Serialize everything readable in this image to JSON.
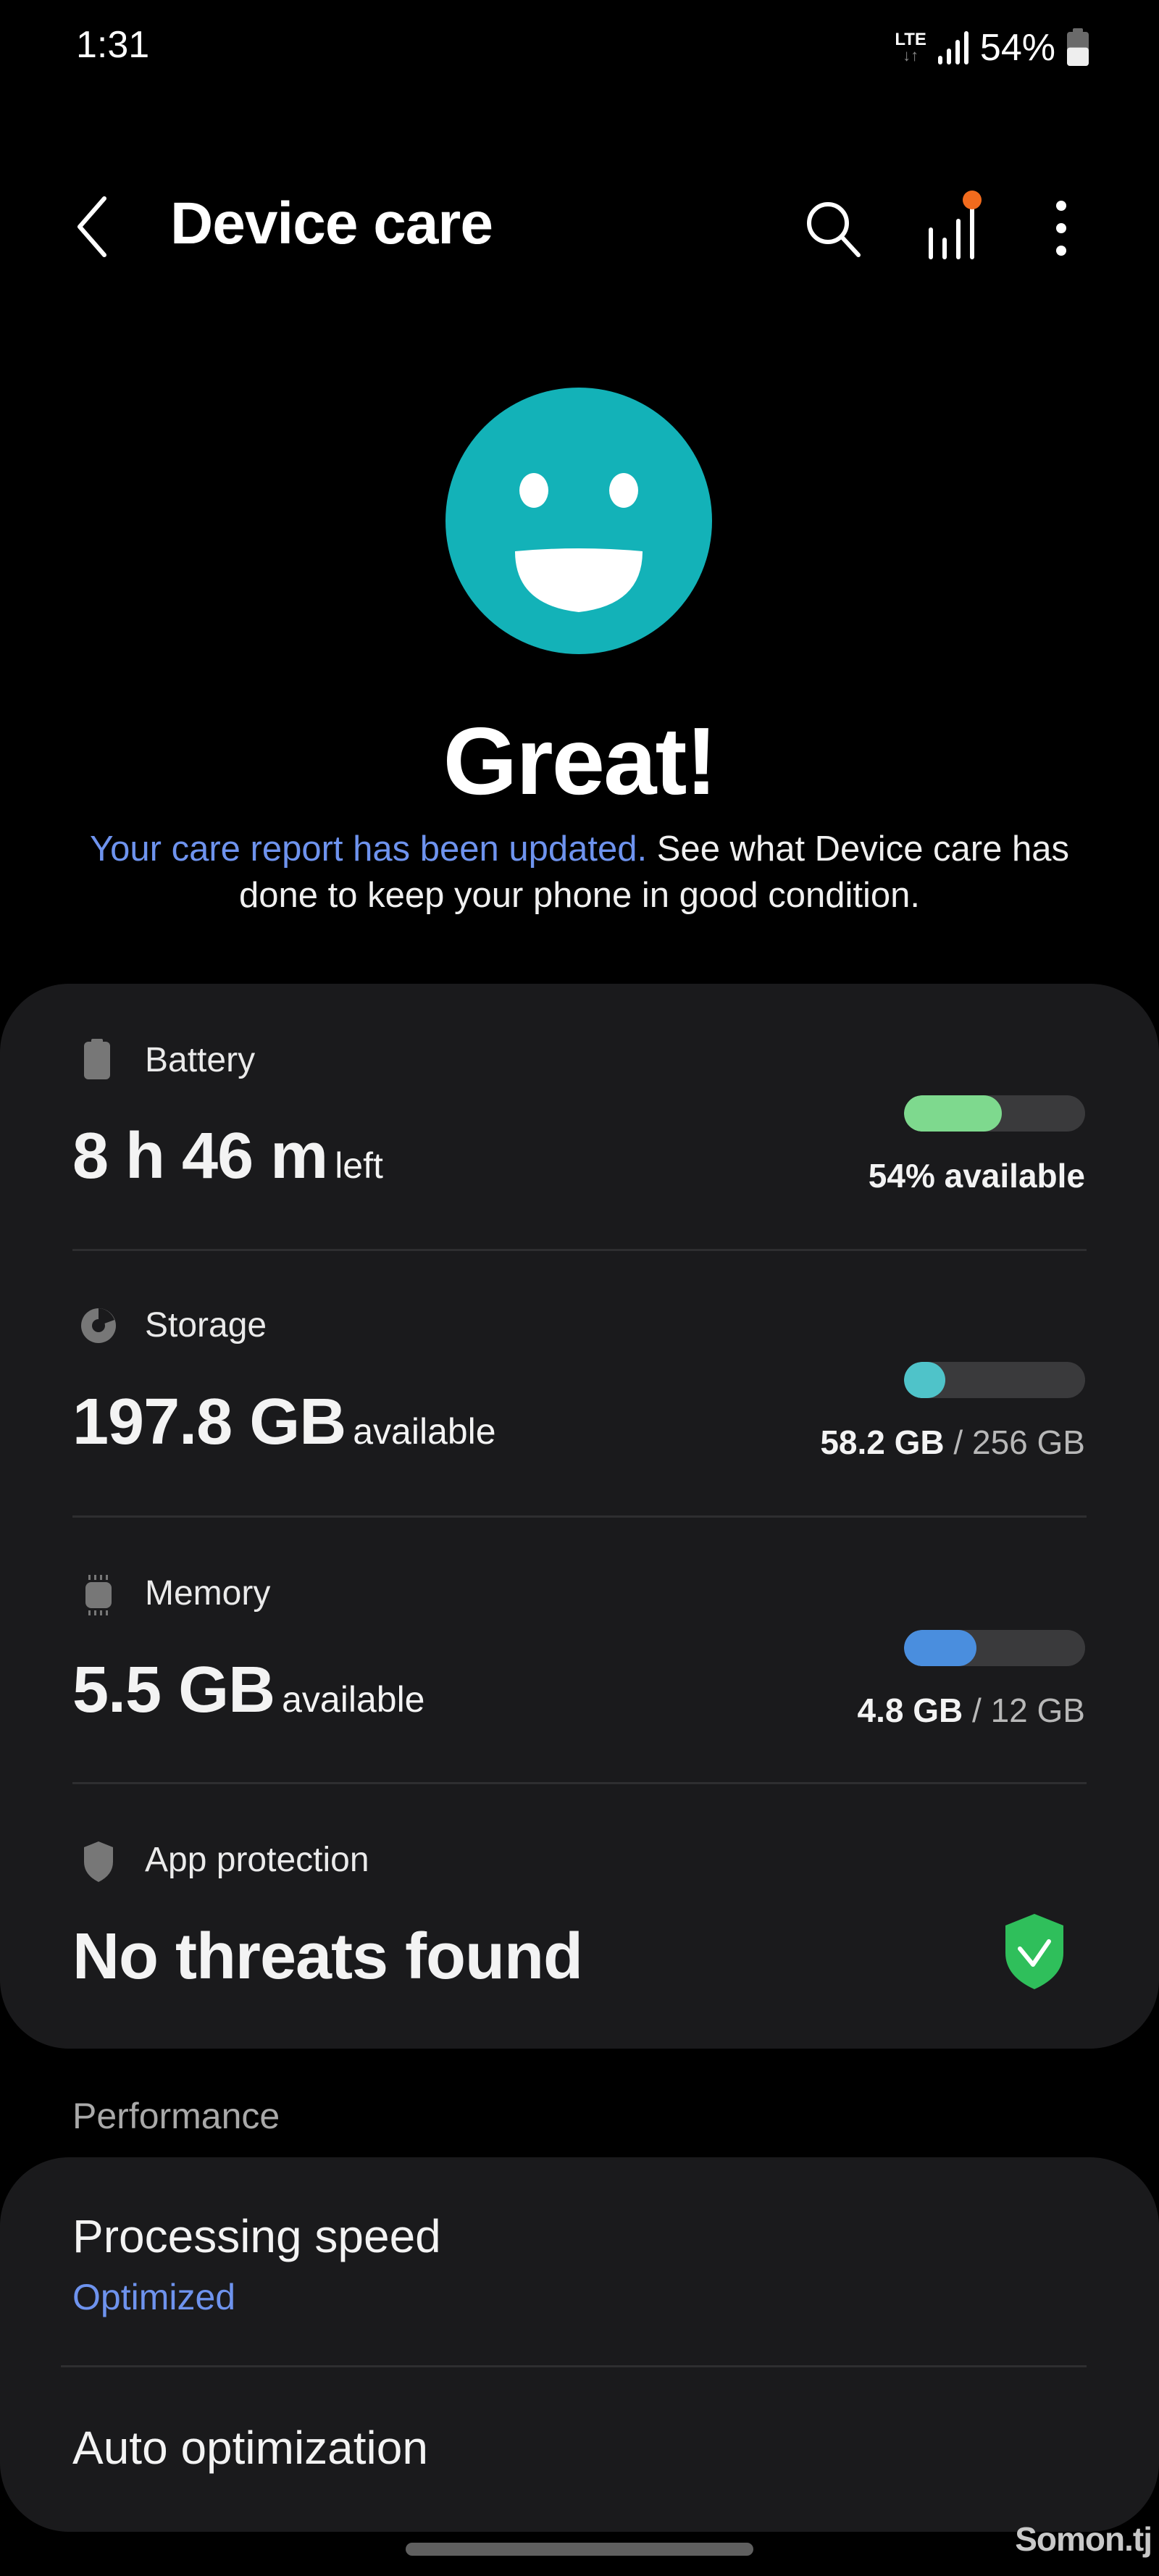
{
  "status_bar": {
    "time": "1:31",
    "network": "LTE",
    "network_arrows": "↓↑",
    "battery_percent": "54%",
    "battery_level": 0.54
  },
  "header": {
    "title": "Device care",
    "back_icon": "chevron-left-icon",
    "actions": [
      {
        "name": "search",
        "icon": "search-icon"
      },
      {
        "name": "reports",
        "icon": "bar-stats-icon",
        "badge_color": "#f26b1d"
      },
      {
        "name": "more-options",
        "icon": "more-vertical-icon"
      }
    ]
  },
  "hero": {
    "icon": "smiley-face-icon",
    "icon_color": "#13b2b8",
    "headline": "Great!",
    "link_text": "Your care report has been updated.",
    "description": " See what Device care has done to keep your phone in good condition."
  },
  "summary": {
    "battery": {
      "label": "Battery",
      "value": "8 h 46 m",
      "unit": "left",
      "caption_bold": "54% available",
      "level": 0.54,
      "color": "#7ed98e"
    },
    "storage": {
      "label": "Storage",
      "value": "197.8 GB",
      "unit": "available",
      "used": "58.2 GB",
      "separator": " / ",
      "total": "256 GB",
      "level": 0.227,
      "color": "#4fc3c9"
    },
    "memory": {
      "label": "Memory",
      "value": "5.5 GB",
      "unit": "available",
      "used": "4.8 GB",
      "separator": " / ",
      "total": "12 GB",
      "level": 0.4,
      "color": "#4a8ede"
    },
    "app_protection": {
      "label": "App protection",
      "value": "No threats found",
      "status_color": "#2fbf5b"
    }
  },
  "performance": {
    "section_title": "Performance",
    "items": [
      {
        "title": "Processing speed",
        "subtitle": "Optimized"
      },
      {
        "title": "Auto optimization"
      }
    ]
  },
  "watermark": "Somon.tj"
}
